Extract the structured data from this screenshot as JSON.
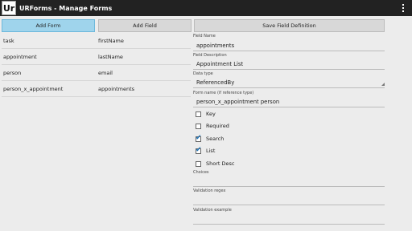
{
  "app": {
    "logo": "Ur",
    "title": "URForms - Manage Forms"
  },
  "toolbar": {
    "add_form": "Add Form",
    "add_field": "Add Field",
    "save_field_definition": "Save Field Definition"
  },
  "forms": [
    {
      "name": "task",
      "field": "firstName"
    },
    {
      "name": "appointment",
      "field": "lastName"
    },
    {
      "name": "person",
      "field": "email"
    },
    {
      "name": "person_x_appointment",
      "field": "appointments"
    }
  ],
  "detail": {
    "field_name_label": "Field Name",
    "field_name_value": "appointments",
    "field_description_label": "Field Description",
    "field_description_value": "Appointment List",
    "data_type_label": "Data type",
    "data_type_value": "ReferencedBy",
    "form_name_label": "Form name (if reference type)",
    "form_name_value": "person_x_appointment person",
    "checkboxes": [
      {
        "label": "Key",
        "checked": false
      },
      {
        "label": "Required",
        "checked": false
      },
      {
        "label": "Search",
        "checked": true
      },
      {
        "label": "List",
        "checked": true
      },
      {
        "label": "Short Desc",
        "checked": false
      }
    ],
    "choices_label": "Choices",
    "validation_regex_label": "Validation regex",
    "validation_example_label": "Validation example"
  },
  "colors": {
    "actionbar": "#222222",
    "active_button": "#9fd4ec",
    "check": "#1a6fb3"
  }
}
